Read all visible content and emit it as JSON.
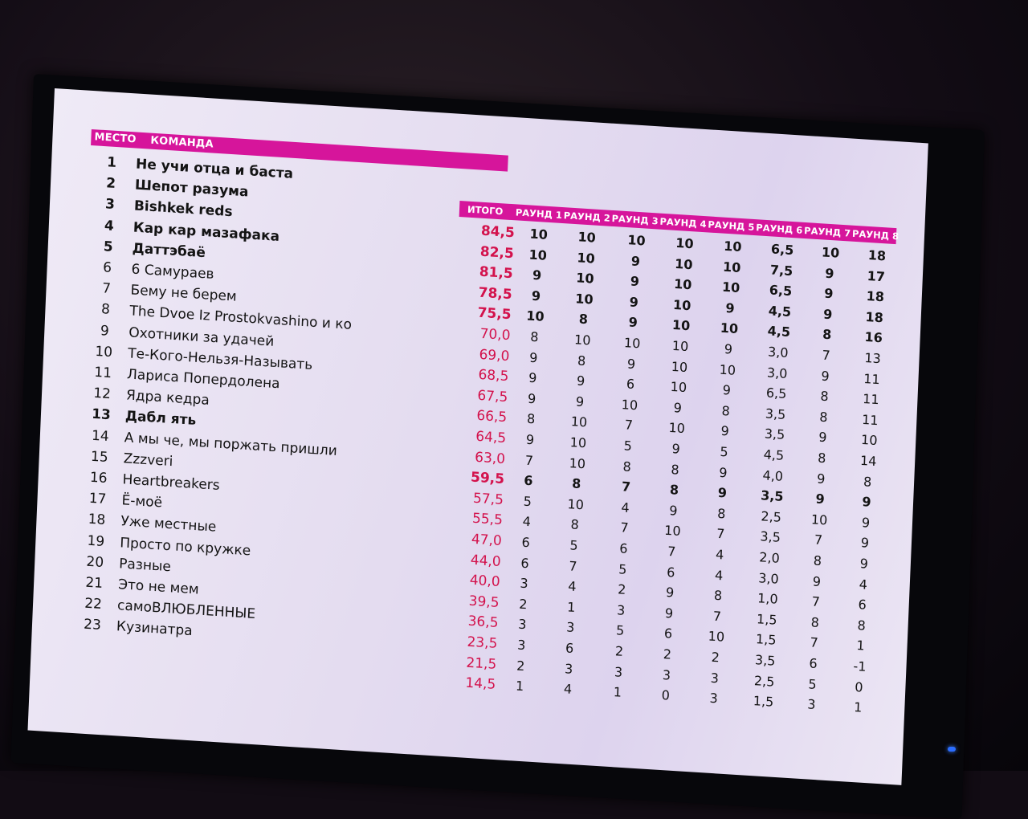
{
  "headers": {
    "place": "МЕСТО",
    "team": "КОМАНДА",
    "total": "ИТОГО",
    "rounds": [
      "РАУНД 1",
      "РАУНД 2",
      "РАУНД 3",
      "РАУНД 4",
      "РАУНД 5",
      "РАУНД 6",
      "РАУНД 7",
      "РАУНД 8"
    ]
  },
  "colors": {
    "accent": "#d6159b",
    "score": "#d3124c",
    "screen": "#e6def2"
  },
  "teams": [
    {
      "place": "1",
      "name": "Не учи отца и баста",
      "bold": true
    },
    {
      "place": "2",
      "name": "Шепот разума",
      "bold": true
    },
    {
      "place": "3",
      "name": "Bishkek reds",
      "bold": true
    },
    {
      "place": "4",
      "name": "Кар кар мазафака",
      "bold": true
    },
    {
      "place": "5",
      "name": "Даттэбаё",
      "bold": true
    },
    {
      "place": "6",
      "name": "6 Самураев",
      "bold": false
    },
    {
      "place": "7",
      "name": "Бему не берем",
      "bold": false
    },
    {
      "place": "8",
      "name": "The Dvoe Iz Prostokvashino и ко",
      "bold": false
    },
    {
      "place": "9",
      "name": "Охотники за удачей",
      "bold": false
    },
    {
      "place": "10",
      "name": "Те-Кого-Нельзя-Называть",
      "bold": false
    },
    {
      "place": "11",
      "name": "Лариса Попердолена",
      "bold": false
    },
    {
      "place": "12",
      "name": "Ядра кедра",
      "bold": false
    },
    {
      "place": "13",
      "name": "Дабл ять",
      "bold": true
    },
    {
      "place": "14",
      "name": "А мы че, мы поржать пришли",
      "bold": false
    },
    {
      "place": "15",
      "name": "Zzzveri",
      "bold": false
    },
    {
      "place": "16",
      "name": "Heartbreakers",
      "bold": false
    },
    {
      "place": "17",
      "name": "Ё-моё",
      "bold": false
    },
    {
      "place": "18",
      "name": "Уже местные",
      "bold": false
    },
    {
      "place": "19",
      "name": "Просто по кружке",
      "bold": false
    },
    {
      "place": "20",
      "name": "Разные",
      "bold": false
    },
    {
      "place": "21",
      "name": "Это не мем",
      "bold": false
    },
    {
      "place": "22",
      "name": "самоВЛЮБЛЕННЫЕ",
      "bold": false
    },
    {
      "place": "23",
      "name": "Кузинатра",
      "bold": false
    }
  ],
  "scores": [
    {
      "total": "84,5",
      "rounds": [
        "10",
        "10",
        "10",
        "10",
        "10",
        "6,5",
        "10",
        "18"
      ],
      "bold": true
    },
    {
      "total": "82,5",
      "rounds": [
        "10",
        "10",
        "9",
        "10",
        "10",
        "7,5",
        "9",
        "17"
      ],
      "bold": true
    },
    {
      "total": "81,5",
      "rounds": [
        "9",
        "10",
        "9",
        "10",
        "10",
        "6,5",
        "9",
        "18"
      ],
      "bold": true
    },
    {
      "total": "78,5",
      "rounds": [
        "9",
        "10",
        "9",
        "10",
        "9",
        "4,5",
        "9",
        "18"
      ],
      "bold": true
    },
    {
      "total": "75,5",
      "rounds": [
        "10",
        "8",
        "9",
        "10",
        "10",
        "4,5",
        "8",
        "16"
      ],
      "bold": true
    },
    {
      "total": "70,0",
      "rounds": [
        "8",
        "10",
        "10",
        "10",
        "9",
        "3,0",
        "7",
        "13"
      ],
      "bold": false
    },
    {
      "total": "69,0",
      "rounds": [
        "9",
        "8",
        "9",
        "10",
        "10",
        "3,0",
        "9",
        "11"
      ],
      "bold": false
    },
    {
      "total": "68,5",
      "rounds": [
        "9",
        "9",
        "6",
        "10",
        "9",
        "6,5",
        "8",
        "11"
      ],
      "bold": false
    },
    {
      "total": "67,5",
      "rounds": [
        "9",
        "9",
        "10",
        "9",
        "8",
        "3,5",
        "8",
        "11"
      ],
      "bold": false
    },
    {
      "total": "66,5",
      "rounds": [
        "8",
        "10",
        "7",
        "10",
        "9",
        "3,5",
        "9",
        "10"
      ],
      "bold": false
    },
    {
      "total": "64,5",
      "rounds": [
        "9",
        "10",
        "5",
        "9",
        "5",
        "4,5",
        "8",
        "14"
      ],
      "bold": false
    },
    {
      "total": "63,0",
      "rounds": [
        "7",
        "10",
        "8",
        "8",
        "9",
        "4,0",
        "9",
        "8"
      ],
      "bold": false
    },
    {
      "total": "59,5",
      "rounds": [
        "6",
        "8",
        "7",
        "8",
        "9",
        "3,5",
        "9",
        "9"
      ],
      "bold": true
    },
    {
      "total": "57,5",
      "rounds": [
        "5",
        "10",
        "4",
        "9",
        "8",
        "2,5",
        "10",
        "9"
      ],
      "bold": false
    },
    {
      "total": "55,5",
      "rounds": [
        "4",
        "8",
        "7",
        "10",
        "7",
        "3,5",
        "7",
        "9"
      ],
      "bold": false
    },
    {
      "total": "47,0",
      "rounds": [
        "6",
        "5",
        "6",
        "7",
        "4",
        "2,0",
        "8",
        "9"
      ],
      "bold": false
    },
    {
      "total": "44,0",
      "rounds": [
        "6",
        "7",
        "5",
        "6",
        "4",
        "3,0",
        "9",
        "4"
      ],
      "bold": false
    },
    {
      "total": "40,0",
      "rounds": [
        "3",
        "4",
        "2",
        "9",
        "8",
        "1,0",
        "7",
        "6"
      ],
      "bold": false
    },
    {
      "total": "39,5",
      "rounds": [
        "2",
        "1",
        "3",
        "9",
        "7",
        "1,5",
        "8",
        "8"
      ],
      "bold": false
    },
    {
      "total": "36,5",
      "rounds": [
        "3",
        "3",
        "5",
        "6",
        "10",
        "1,5",
        "7",
        "1"
      ],
      "bold": false
    },
    {
      "total": "23,5",
      "rounds": [
        "3",
        "6",
        "2",
        "2",
        "2",
        "3,5",
        "6",
        "-1"
      ],
      "bold": false
    },
    {
      "total": "21,5",
      "rounds": [
        "2",
        "3",
        "3",
        "3",
        "3",
        "2,5",
        "5",
        "0"
      ],
      "bold": false
    },
    {
      "total": "14,5",
      "rounds": [
        "1",
        "4",
        "1",
        "0",
        "3",
        "1,5",
        "3",
        "1"
      ],
      "bold": false
    }
  ]
}
